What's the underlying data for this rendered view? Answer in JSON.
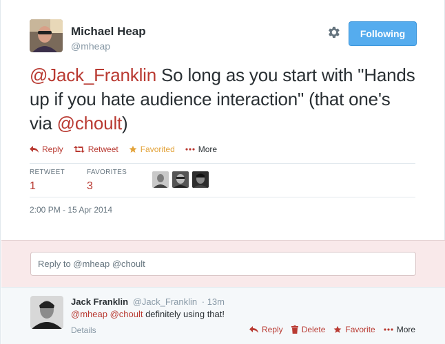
{
  "tweet": {
    "author_name": "Michael Heap",
    "author_handle": "@mheap",
    "follow_label": "Following",
    "text_parts": {
      "mention1": "@Jack_Franklin",
      "text1": " So long as you start with \"Hands up if you hate audience interaction\" (that one's via ",
      "mention2": "@choult",
      "text2": ")"
    },
    "actions": {
      "reply": "Reply",
      "retweet": "Retweet",
      "favorite": "Favorited",
      "more": "More"
    },
    "stats": {
      "retweet_label": "RETWEET",
      "retweet_count": "1",
      "favorites_label": "FAVORITES",
      "favorites_count": "3"
    },
    "timestamp": "2:00 PM - 15 Apr 2014"
  },
  "reply_box": {
    "placeholder": "Reply to @mheap @choult"
  },
  "reply_tweet": {
    "author_name": "Jack Franklin",
    "author_handle": "@Jack_Franklin",
    "time": "· 13m",
    "mention1": "@mheap",
    "mention2": "@choult",
    "text": " definitely using that!",
    "details": "Details",
    "actions": {
      "reply": "Reply",
      "delete": "Delete",
      "favorite": "Favorite",
      "more": "More"
    }
  },
  "colors": {
    "link": "#b93a32",
    "follow_button": "#55acee",
    "favorited": "#e3a33a",
    "reply_zone": "#f9e9ea"
  },
  "icons": [
    "gear-icon",
    "reply-icon",
    "retweet-icon",
    "star-icon",
    "more-icon",
    "trash-icon"
  ]
}
